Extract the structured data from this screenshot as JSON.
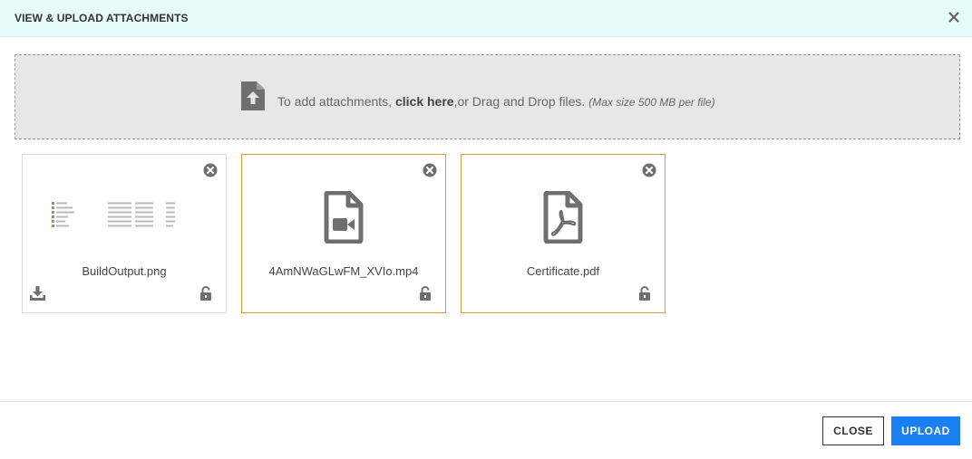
{
  "dialog": {
    "title": "VIEW & UPLOAD ATTACHMENTS",
    "close_icon": "close-x-icon"
  },
  "dropzone": {
    "text_before": "To add attachments, ",
    "link_text": "click here",
    "text_after": ",or Drag and Drop files. ",
    "size_note": "(Max size 500 MB per file)",
    "icon": "file-upload-icon"
  },
  "attachments": [
    {
      "filename": "BuildOutput.png",
      "kind": "image",
      "downloadable": true,
      "icon": "image-thumbnail"
    },
    {
      "filename": "4AmNWaGLwFM_XVIo.mp4",
      "kind": "video",
      "downloadable": false,
      "icon": "file-video-icon"
    },
    {
      "filename": "Certificate.pdf",
      "kind": "pdf",
      "downloadable": false,
      "icon": "file-pdf-icon"
    }
  ],
  "footer": {
    "close_label": "CLOSE",
    "upload_label": "UPLOAD"
  },
  "colors": {
    "header_bg": "#e8fbfb",
    "dropzone_bg": "#e7e7e7",
    "card_highlight": "#d99a3f",
    "primary": "#1a7ff0",
    "icon_gray": "#6f6f6f"
  }
}
